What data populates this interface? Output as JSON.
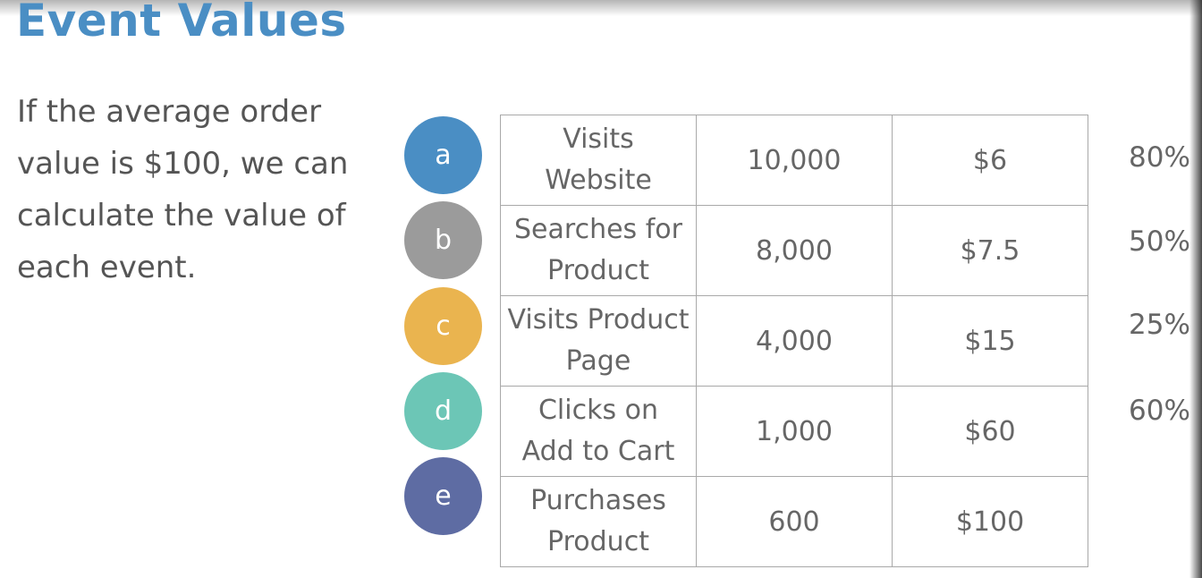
{
  "title": "Event Values",
  "intro_lines": [
    "If the average order",
    "value is $100, we can",
    "calculate the value of",
    "each event."
  ],
  "colors": {
    "title": "#4a8ec4",
    "circle_a": "#4a8ec4",
    "circle_b": "#9b9b9b",
    "circle_c": "#eab44f",
    "circle_d": "#6cc6b6",
    "circle_e": "#5e6ca3"
  },
  "events": [
    {
      "letter": "a",
      "name_lines": [
        "Visits",
        "Website"
      ],
      "count": "10,000",
      "value": "$6",
      "conversion": "80%"
    },
    {
      "letter": "b",
      "name_lines": [
        "Searches for",
        "Product"
      ],
      "count": "8,000",
      "value": "$7.5",
      "conversion": "50%"
    },
    {
      "letter": "c",
      "name_lines": [
        "Visits Product",
        "Page"
      ],
      "count": "4,000",
      "value": "$15",
      "conversion": "25%"
    },
    {
      "letter": "d",
      "name_lines": [
        "Clicks on",
        "Add to Cart"
      ],
      "count": "1,000",
      "value": "$60",
      "conversion": "60%"
    },
    {
      "letter": "e",
      "name_lines": [
        "Purchases",
        "Product"
      ],
      "count": "600",
      "value": "$100"
    }
  ]
}
